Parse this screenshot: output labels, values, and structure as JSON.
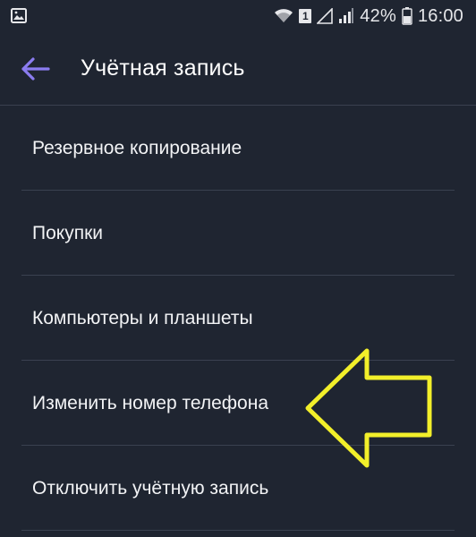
{
  "status_bar": {
    "battery_percent": "42%",
    "time": "16:00",
    "sim_slot": "1",
    "icons": [
      "gallery-icon",
      "wifi-icon",
      "sim-card-icon",
      "signal-icon",
      "battery-icon"
    ]
  },
  "toolbar": {
    "title": "Учётная запись",
    "back_icon": "arrow-left-icon"
  },
  "menu": {
    "items": [
      {
        "label": "Резервное копирование"
      },
      {
        "label": "Покупки"
      },
      {
        "label": "Компьютеры и планшеты"
      },
      {
        "label": "Изменить номер телефона"
      },
      {
        "label": "Отключить учётную запись"
      }
    ]
  },
  "annotation": {
    "icon": "arrow-left-icon",
    "color": "#f2ef2a"
  },
  "colors": {
    "background": "#1f2531",
    "accent": "#8b7cf0",
    "divider": "#3a4150",
    "text": "#f2f3f5"
  }
}
